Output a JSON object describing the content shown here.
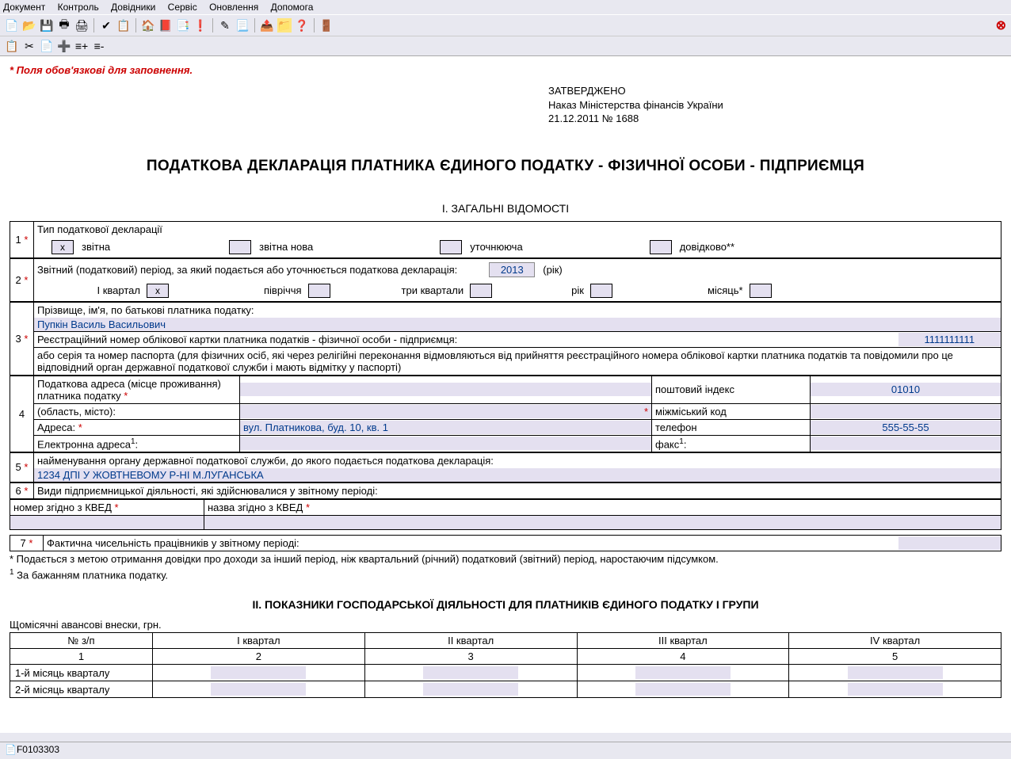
{
  "menu": {
    "items": [
      "Документ",
      "Контроль",
      "Довідники",
      "Сервіс",
      "Оновлення",
      "Допомога"
    ]
  },
  "required_note": "* Поля обов'язкові для заповнення.",
  "approval": {
    "line1": "ЗАТВЕРДЖЕНО",
    "line2": "Наказ Міністерства фінансів України",
    "line3": "21.12.2011 № 1688"
  },
  "title": "ПОДАТКОВА ДЕКЛАРАЦІЯ ПЛАТНИКА ЄДИНОГО ПОДАТКУ - ФІЗИЧНОЇ ОСОБИ - ПІДПРИЄМЦЯ",
  "section1": "І. ЗАГАЛЬНІ ВІДОМОСТІ",
  "row1": {
    "num": "1",
    "label": "Тип податкової декларації",
    "opt1_mark": "x",
    "opt1": "звітна",
    "opt2": "звітна нова",
    "opt3": "уточнююча",
    "opt4": "довідково**"
  },
  "row2": {
    "num": "2",
    "label": "Звітний (податковий) період, за який подається або уточнюється податкова декларація:",
    "year": "2013",
    "year_lbl": "(рік)",
    "q1": "І квартал",
    "q1_mark": "x",
    "half": "півріччя",
    "q3": "три квартали",
    "yr": "рік",
    "month": "місяць*"
  },
  "row3": {
    "num": "3",
    "name_label": "Прізвище, ім'я, по батькові платника податку:",
    "name_value": "Пупкін Василь Васильович",
    "reg_label": "Реєстраційний номер облікової картки платника податків - фізичної особи - підприємця:",
    "reg_value": "1111111111",
    "passport_note": "або серія та номер паспорта (для фізичних осіб, які через релігійні переконання відмовляються від прийняття реєстраційного номера облікової картки платника податків та повідомили про це відповідний орган державної податкової служби і мають відмітку у паспорті)"
  },
  "row4": {
    "num": "4",
    "addr_label": "Податкова адреса (місце проживання) платника податку",
    "region_label": "(область, місто):",
    "street_label": "Адреса:",
    "street_value": "вул. Платникова, буд. 10, кв. 1",
    "email_label": "Електронна адреса",
    "zip_label": "поштовий індекс",
    "zip_value": "01010",
    "citycode_label": "міжміський код",
    "phone_label": "телефон",
    "phone_value": "555-55-55",
    "fax_label": "факс"
  },
  "row5": {
    "num": "5",
    "label": "найменування органу державної податкової служби, до якого подається податкова декларація:",
    "value": "1234 ДПІ У ЖОВТНЕВОМУ Р-НІ М.ЛУГАНСЬКА"
  },
  "row6": {
    "num": "6",
    "label": "Види підприємницької діяльності, які здійснювалися у звітному періоді:",
    "kved_num": "номер згідно з КВЕД",
    "kved_name": "назва згідно з КВЕД"
  },
  "row7": {
    "num": "7",
    "label": "Фактична чисельність працівників у звітному періоді:"
  },
  "footnote1": "* Подається з метою отримання довідки про доходи за інший період, ніж квартальний (річний) податковий (звітний) період, наростаючим підсумком.",
  "footnote2_sup": "1",
  "footnote2": " За бажанням платника податку.",
  "section2": "ІІ. ПОКАЗНИКИ ГОСПОДАРСЬКОЇ ДІЯЛЬНОСТІ ДЛЯ ПЛАТНИКІВ ЄДИНОГО ПОДАТКУ І ГРУПИ",
  "advances_label": "Щомісячні авансові внески, грн.",
  "tbl": {
    "headers": [
      "№ з/п",
      "І квартал",
      "ІІ квартал",
      "ІІІ квартал",
      "IV квартал"
    ],
    "nums": [
      "1",
      "2",
      "3",
      "4",
      "5"
    ],
    "rows": [
      "1-й місяць кварталу",
      "2-й місяць кварталу"
    ]
  },
  "status": "F0103303"
}
